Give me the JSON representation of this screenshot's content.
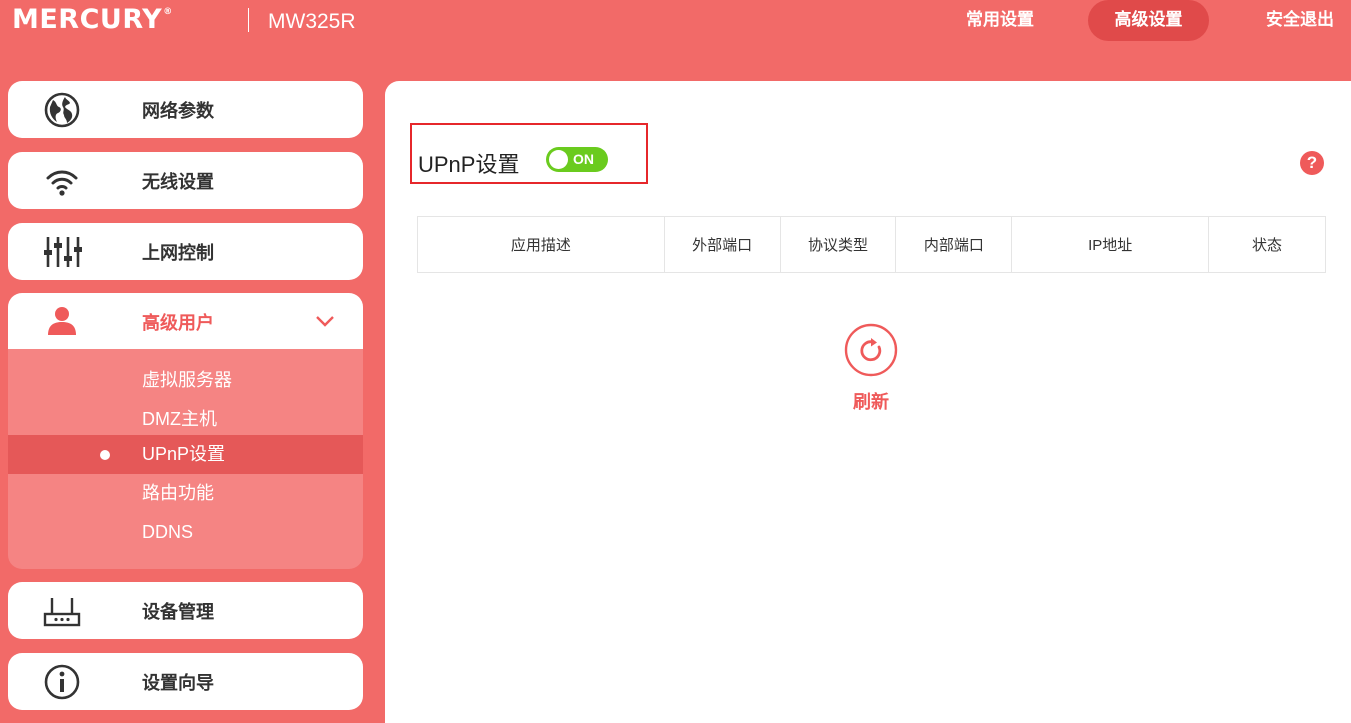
{
  "brand": {
    "logo": "MERCURY",
    "reg": "®",
    "model": "MW325R"
  },
  "topnav": {
    "common": "常用设置",
    "advanced": "高级设置",
    "logout": "安全退出"
  },
  "sidebar": {
    "items": [
      {
        "label": "网络参数",
        "icon": "globe-icon"
      },
      {
        "label": "无线设置",
        "icon": "wifi-icon"
      },
      {
        "label": "上网控制",
        "icon": "sliders-icon"
      },
      {
        "label": "高级用户",
        "icon": "user-icon",
        "expanded": true
      },
      {
        "label": "设备管理",
        "icon": "router-icon"
      },
      {
        "label": "设置向导",
        "icon": "info-icon"
      }
    ],
    "submenu": [
      {
        "label": "虚拟服务器"
      },
      {
        "label": "DMZ主机"
      },
      {
        "label": "UPnP设置",
        "active": true
      },
      {
        "label": "路由功能"
      },
      {
        "label": "DDNS"
      }
    ]
  },
  "main": {
    "title": "UPnP设置",
    "toggle": "ON",
    "help": "?",
    "table": {
      "columns": [
        "应用描述",
        "外部端口",
        "协议类型",
        "内部端口",
        "IP地址",
        "状态"
      ]
    },
    "refresh_label": "刷新"
  },
  "colors": {
    "brand": "#f26a68",
    "accent": "#ef5a5a",
    "active_sub": "#e55858",
    "toggle_on": "#6acb1e",
    "highlight_box": "#e6272b"
  }
}
